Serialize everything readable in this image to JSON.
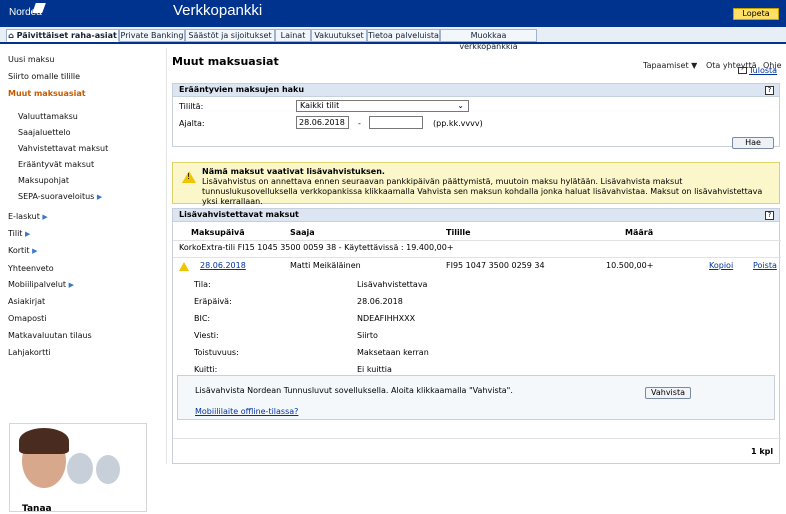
{
  "header": {
    "logo": "Nordea",
    "app_title": "Verkkopankki",
    "logout": "Lopeta"
  },
  "tabs": [
    {
      "label": "Päivittäiset raha-asiat"
    },
    {
      "label": "Private Banking"
    },
    {
      "label": "Säästöt ja sijoitukset"
    },
    {
      "label": "Lainat"
    },
    {
      "label": "Vakuutukset"
    },
    {
      "label": "Tietoa palveluista"
    },
    {
      "label": "Muokkaa verkkopankkia"
    }
  ],
  "utility": {
    "settings": "Tapaamiset",
    "contact": "Ota yhteyttä",
    "help": "Ohje"
  },
  "sidebar": {
    "items": [
      {
        "label": "Uusi maksu"
      },
      {
        "label": "Siirto omalle tilille"
      },
      {
        "label": "Muut maksuasiat"
      },
      {
        "label": "Valuuttamaksu"
      },
      {
        "label": "Saajaluettelo"
      },
      {
        "label": "Vahvistettavat maksut"
      },
      {
        "label": "Erääntyvät maksut"
      },
      {
        "label": "Maksupohjat"
      },
      {
        "label": "SEPA-suoraveloitus"
      },
      {
        "label": "E-laskut"
      },
      {
        "label": "Tilit"
      },
      {
        "label": "Kortit"
      },
      {
        "label": "Yhteenveto"
      },
      {
        "label": "Mobiilipalvelut"
      },
      {
        "label": "Asiakirjat"
      },
      {
        "label": "Omaposti"
      },
      {
        "label": "Matkavaluutan tilaus"
      },
      {
        "label": "Lahjakortti"
      }
    ],
    "advisor": "Tanaa"
  },
  "main": {
    "title": "Muut maksuasiat",
    "print": "Tulosta",
    "search": {
      "title": "Erääntyvien maksujen haku",
      "account_label": "Tililtä:",
      "account_value": "Kaikki tilit",
      "date_label": "Ajalta:",
      "date_from": "28.06.2018",
      "date_separator": "-",
      "date_to": "",
      "date_hint": "(pp.kk.vvvv)",
      "search_button": "Hae"
    },
    "warning": {
      "title": "Nämä maksut vaativat lisävahvistuksen.",
      "text": "Lisävahvistus on annettava ennen seuraavan pankkipäivän päättymistä, muutoin maksu hylätään. Lisävahvista maksut tunnuslukusovelluksella verkkopankissa klikkaamalla Vahvista sen maksun kohdalla jonka haluat lisävahvistaa. Maksut on lisävahvistettava yksi kerrallaan."
    },
    "payments": {
      "title": "Lisävahvistettavat maksut",
      "headers": {
        "date": "Maksupäivä",
        "payee": "Saaja",
        "to_account": "Tilille",
        "amount": "Määrä"
      },
      "account_line": "KorkoExtra-tili FI15 1045 3500 0059 38  - Käytettävissä : 19.400,00+",
      "row": {
        "date": "28.06.2018",
        "payee": "Matti Meikäläinen",
        "to_account": "FI95 1047 3500 0259 34",
        "amount": "10.500,00+",
        "copy": "Kopioi",
        "delete": "Poista"
      },
      "details": [
        {
          "label": "Tila:",
          "value": "Lisävahvistettava"
        },
        {
          "label": "Eräpäivä:",
          "value": "28.06.2018"
        },
        {
          "label": "BIC:",
          "value": "NDEAFIHHXXX"
        },
        {
          "label": "Viesti:",
          "value": "Siirto"
        },
        {
          "label": "Toistuvuus:",
          "value": "Maksetaan kerran"
        },
        {
          "label": "Kuitti:",
          "value": "Ei kuittia"
        }
      ],
      "confirm_text": "Lisävahvista Nordean Tunnusluvut sovelluksella. Aloita klikkaamalla \"Vahvista\".",
      "confirm_button": "Vahvista",
      "offline_link": "Mobiililaite offline-tilassa?",
      "count": "1 kpl"
    }
  }
}
